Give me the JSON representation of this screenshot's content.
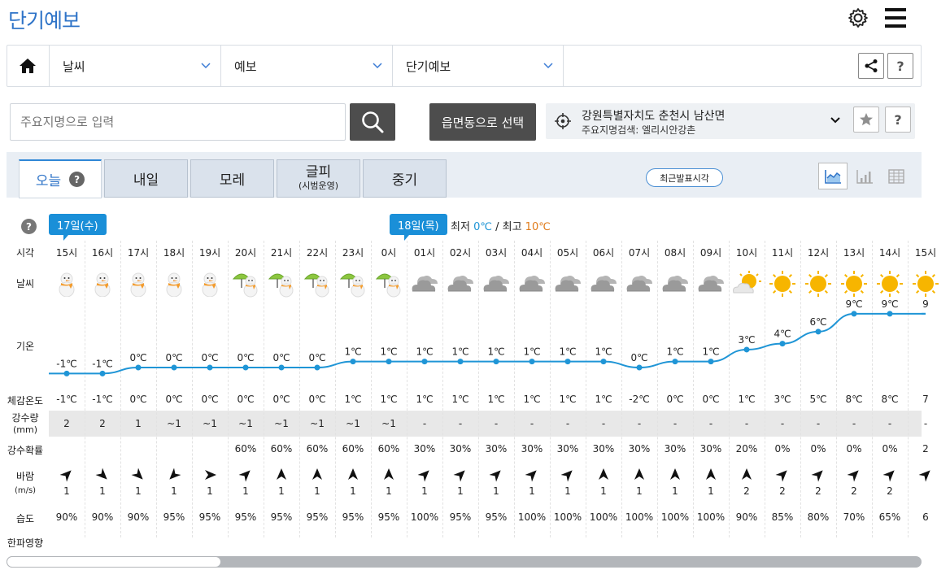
{
  "header": {
    "title": "단기예보"
  },
  "nav": {
    "home_icon": "home-icon",
    "items": [
      {
        "label": "날씨"
      },
      {
        "label": "예보"
      },
      {
        "label": "단기예보"
      }
    ],
    "share_icon": "share-icon",
    "help_label": "?"
  },
  "search": {
    "placeholder": "주요지명으로 입력",
    "button_icon": "search-icon"
  },
  "select_button": {
    "label": "읍면동으로 선택"
  },
  "location": {
    "name": "강원특별자치도 춘천시 남산면",
    "sub": "주요지명검색: 엘리시안강촌",
    "help_label": "?"
  },
  "tabs": [
    {
      "label": "오늘",
      "sub": "",
      "help": "?"
    },
    {
      "label": "내일",
      "sub": ""
    },
    {
      "label": "모레",
      "sub": ""
    },
    {
      "label": "글피",
      "sub": "(시범운영)"
    },
    {
      "label": "중기",
      "sub": ""
    }
  ],
  "recent_button": {
    "label": "최근발표시각"
  },
  "views": [
    "line-chart-icon",
    "bar-chart-icon",
    "table-icon"
  ],
  "colors": {
    "accent": "#2f74c8",
    "temp_line": "#1f95d6",
    "min_temp": "#1f95d6",
    "max_temp": "#e07b1a"
  },
  "forecast": {
    "help": "?",
    "day_flags": [
      {
        "label": "17일(수)"
      },
      {
        "label": "18일(목)"
      }
    ],
    "minmax": {
      "min_label": "최저",
      "min": "0℃",
      "sep": "/",
      "max_label": "최고",
      "max": "10℃"
    },
    "labels": {
      "time": "시각",
      "weather": "날씨",
      "temp": "기온",
      "feels": "체감온도",
      "precip": "강수량",
      "precip_unit": "(mm)",
      "prob": "강수확률",
      "wind": "바람",
      "wind_unit": "(m/s)",
      "humidity": "습도",
      "cold": "한파영향"
    },
    "hours": [
      "15시",
      "16시",
      "17시",
      "18시",
      "19시",
      "20시",
      "21시",
      "22시",
      "23시",
      "0시",
      "01시",
      "02시",
      "03시",
      "04시",
      "05시",
      "06시",
      "07시",
      "08시",
      "09시",
      "10시",
      "11시",
      "12시",
      "13시",
      "14시",
      "15시"
    ],
    "weather": [
      "snow",
      "snow",
      "snow",
      "snow",
      "snow",
      "rain-snow",
      "rain-snow",
      "rain-snow",
      "rain-snow",
      "rain-snow",
      "cloudy",
      "cloudy",
      "cloudy",
      "cloudy",
      "cloudy",
      "cloudy",
      "cloudy",
      "cloudy",
      "cloudy",
      "partly-sunny",
      "sunny",
      "sunny",
      "sunny",
      "sunny",
      "sunny"
    ],
    "temps": [
      -1,
      -1,
      0,
      0,
      0,
      0,
      0,
      0,
      1,
      1,
      1,
      1,
      1,
      1,
      1,
      1,
      0,
      1,
      1,
      3,
      4,
      6,
      9,
      9,
      9
    ],
    "temp_labels": [
      "-1℃",
      "-1℃",
      "0℃",
      "0℃",
      "0℃",
      "0℃",
      "0℃",
      "0℃",
      "1℃",
      "1℃",
      "1℃",
      "1℃",
      "1℃",
      "1℃",
      "1℃",
      "1℃",
      "0℃",
      "1℃",
      "1℃",
      "3℃",
      "4℃",
      "6℃",
      "9℃",
      "9℃",
      "9"
    ],
    "feels": [
      "-1℃",
      "-1℃",
      "0℃",
      "0℃",
      "0℃",
      "0℃",
      "0℃",
      "0℃",
      "1℃",
      "1℃",
      "1℃",
      "1℃",
      "1℃",
      "1℃",
      "1℃",
      "1℃",
      "-2℃",
      "0℃",
      "0℃",
      "1℃",
      "3℃",
      "5℃",
      "8℃",
      "8℃",
      "7"
    ],
    "precip": [
      "2",
      "2",
      "1",
      "~1",
      "~1",
      "~1",
      "~1",
      "~1",
      "~1",
      "~1",
      "-",
      "-",
      "-",
      "-",
      "-",
      "-",
      "-",
      "-",
      "-",
      "-",
      "-",
      "-",
      "-",
      "-",
      "-"
    ],
    "prob": [
      "",
      "",
      "",
      "",
      "",
      "60%",
      "60%",
      "60%",
      "60%",
      "60%",
      "30%",
      "30%",
      "30%",
      "30%",
      "30%",
      "30%",
      "30%",
      "30%",
      "30%",
      "20%",
      "0%",
      "0%",
      "0%",
      "0%",
      "2"
    ],
    "wind_dir": [
      225,
      315,
      315,
      45,
      270,
      225,
      180,
      180,
      180,
      180,
      225,
      225,
      225,
      225,
      225,
      180,
      180,
      180,
      180,
      180,
      225,
      225,
      225,
      225,
      225
    ],
    "wind_speed": [
      "1",
      "1",
      "1",
      "1",
      "1",
      "1",
      "1",
      "1",
      "1",
      "1",
      "1",
      "1",
      "1",
      "1",
      "1",
      "1",
      "1",
      "1",
      "1",
      "2",
      "2",
      "2",
      "2",
      "2",
      ""
    ],
    "humidity": [
      "90%",
      "90%",
      "90%",
      "95%",
      "95%",
      "95%",
      "95%",
      "95%",
      "95%",
      "95%",
      "100%",
      "95%",
      "95%",
      "100%",
      "100%",
      "100%",
      "100%",
      "100%",
      "100%",
      "90%",
      "85%",
      "80%",
      "70%",
      "65%",
      "6"
    ]
  }
}
